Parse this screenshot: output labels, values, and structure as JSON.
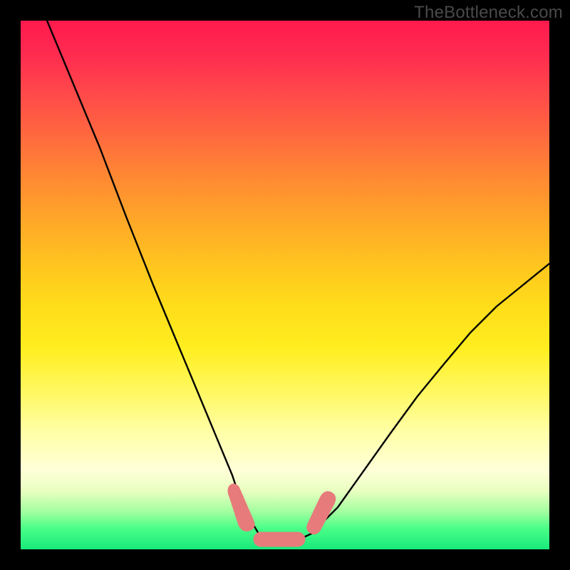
{
  "watermark": "TheBottleneck.com",
  "chart_data": {
    "type": "line",
    "title": "",
    "xlabel": "",
    "ylabel": "",
    "xlim": [
      0,
      100
    ],
    "ylim": [
      0,
      100
    ],
    "series": [
      {
        "name": "bottleneck-curve",
        "x": [
          5,
          10,
          15,
          20,
          25,
          30,
          35,
          40,
          42,
          45,
          48,
          50,
          53,
          55,
          60,
          65,
          70,
          75,
          80,
          85,
          90,
          95,
          100
        ],
        "y": [
          100,
          88,
          76,
          63,
          50,
          38,
          26,
          14,
          8,
          3,
          2,
          2,
          2,
          3,
          8,
          15,
          22,
          29,
          35,
          41,
          46,
          50,
          54
        ]
      }
    ],
    "markers": [
      {
        "name": "salmon-segment-left",
        "x_range": [
          39,
          43
        ],
        "y_level": 8,
        "shape": "rounded-bar"
      },
      {
        "name": "salmon-segment-bottom",
        "x_range": [
          44,
          53
        ],
        "y_level": 2,
        "shape": "rounded-bar"
      },
      {
        "name": "salmon-segment-right",
        "x_range": [
          54,
          58
        ],
        "y_level": 7,
        "shape": "rounded-bar"
      }
    ],
    "colors": {
      "curve": "#000000",
      "markers": "#e77b7b",
      "gradient_top": "#ff1a4d",
      "gradient_bottom": "#18e87a"
    }
  }
}
